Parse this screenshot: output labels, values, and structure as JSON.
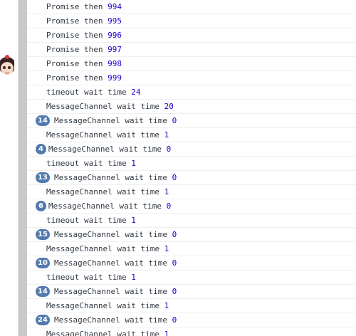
{
  "console": {
    "rows": [
      {
        "label": "Promise then ",
        "value": "994",
        "badge": ""
      },
      {
        "label": "Promise then ",
        "value": "995",
        "badge": ""
      },
      {
        "label": "Promise then ",
        "value": "996",
        "badge": ""
      },
      {
        "label": "Promise then ",
        "value": "997",
        "badge": ""
      },
      {
        "label": "Promise then ",
        "value": "998",
        "badge": ""
      },
      {
        "label": "Promise then ",
        "value": "999",
        "badge": ""
      },
      {
        "label": "timeout wait time ",
        "value": "24",
        "badge": ""
      },
      {
        "label": "MessageChannel wait time ",
        "value": "20",
        "badge": ""
      },
      {
        "label": "MessageChannel wait time ",
        "value": "0",
        "badge": "14"
      },
      {
        "label": "MessageChannel wait time ",
        "value": "1",
        "badge": ""
      },
      {
        "label": "MessageChannel wait time ",
        "value": "0",
        "badge": "4"
      },
      {
        "label": "timeout wait time ",
        "value": "1",
        "badge": ""
      },
      {
        "label": "MessageChannel wait time ",
        "value": "0",
        "badge": "13"
      },
      {
        "label": "MessageChannel wait time ",
        "value": "1",
        "badge": ""
      },
      {
        "label": "MessageChannel wait time ",
        "value": "0",
        "badge": "6"
      },
      {
        "label": "timeout wait time ",
        "value": "1",
        "badge": ""
      },
      {
        "label": "MessageChannel wait time ",
        "value": "0",
        "badge": "15"
      },
      {
        "label": "MessageChannel wait time ",
        "value": "1",
        "badge": ""
      },
      {
        "label": "MessageChannel wait time ",
        "value": "0",
        "badge": "10"
      },
      {
        "label": "timeout wait time ",
        "value": "1",
        "badge": ""
      },
      {
        "label": "MessageChannel wait time ",
        "value": "0",
        "badge": "14"
      },
      {
        "label": "MessageChannel wait time ",
        "value": "1",
        "badge": ""
      },
      {
        "label": "MessageChannel wait time ",
        "value": "0",
        "badge": "24"
      },
      {
        "label": "MessageChannel wait time ",
        "value": "1",
        "badge": ""
      }
    ]
  },
  "colors": {
    "badge": "#527aae",
    "number": "#1c00cf",
    "text": "#303942",
    "gutter": "#c9c9c9"
  },
  "icons": {
    "avatar": "avatar-icon"
  }
}
